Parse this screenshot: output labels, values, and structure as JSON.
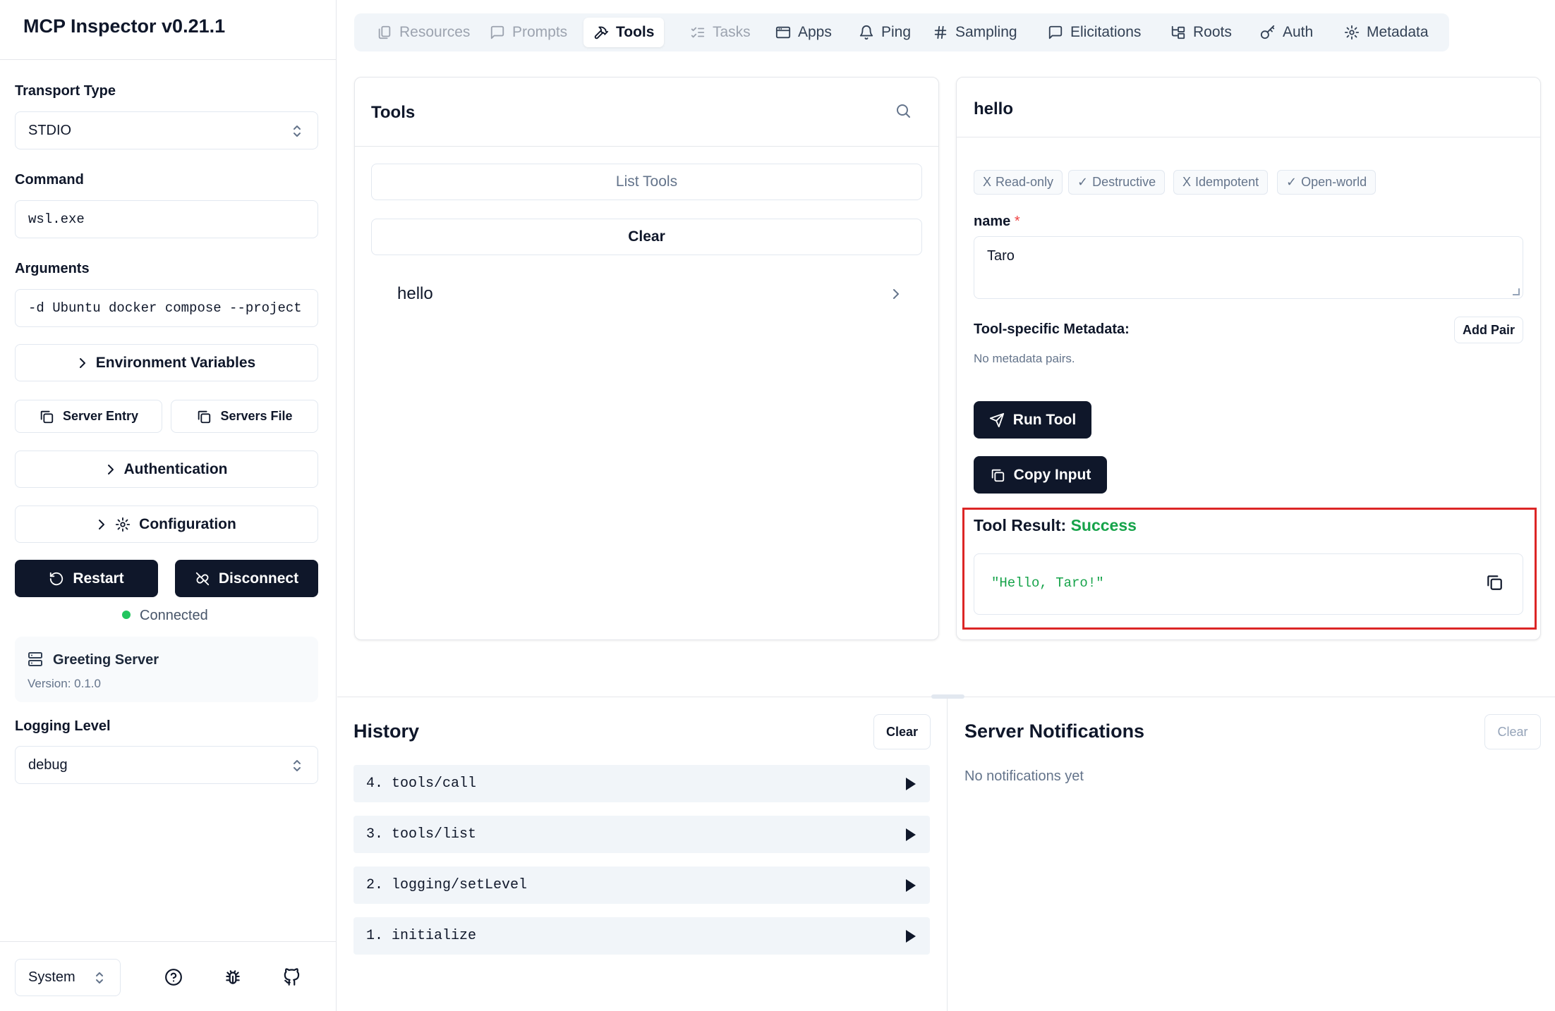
{
  "app": {
    "title": "MCP Inspector v0.21.1"
  },
  "sidebar": {
    "transport_label": "Transport Type",
    "transport_value": "STDIO",
    "command_label": "Command",
    "command_value": "wsl.exe",
    "arguments_label": "Arguments",
    "arguments_value": "-d Ubuntu docker compose --project",
    "env_vars_label": "Environment Variables",
    "server_entry_label": "Server Entry",
    "servers_file_label": "Servers File",
    "auth_label": "Authentication",
    "config_label": "Configuration",
    "restart_label": "Restart",
    "disconnect_label": "Disconnect",
    "status_text": "Connected",
    "status_color": "#22c55e",
    "server_name": "Greeting Server",
    "server_version": "Version: 0.1.0",
    "logging_label": "Logging Level",
    "logging_value": "debug",
    "theme_value": "System"
  },
  "tabs": [
    {
      "label": "Resources",
      "icon": "files-icon",
      "state": "disabled"
    },
    {
      "label": "Prompts",
      "icon": "message-square-icon",
      "state": "disabled"
    },
    {
      "label": "Tools",
      "icon": "hammer-icon",
      "state": "active"
    },
    {
      "label": "Tasks",
      "icon": "list-checks-icon",
      "state": "disabled"
    },
    {
      "label": "Apps",
      "icon": "app-window-icon",
      "state": "enabled"
    },
    {
      "label": "Ping",
      "icon": "bell-icon",
      "state": "enabled"
    },
    {
      "label": "Sampling",
      "icon": "hash-icon",
      "state": "enabled"
    },
    {
      "label": "Elicitations",
      "icon": "message-square-icon",
      "state": "enabled"
    },
    {
      "label": "Roots",
      "icon": "folder-tree-icon",
      "state": "enabled"
    },
    {
      "label": "Auth",
      "icon": "key-icon",
      "state": "enabled"
    },
    {
      "label": "Metadata",
      "icon": "gear-icon",
      "state": "enabled"
    }
  ],
  "tools_panel": {
    "title": "Tools",
    "list_tools_label": "List Tools",
    "clear_label": "Clear",
    "items": [
      {
        "name": "hello"
      }
    ]
  },
  "tool_detail": {
    "title": "hello",
    "annotations": [
      {
        "mark": "X",
        "label": "Read-only"
      },
      {
        "mark": "✓",
        "label": "Destructive"
      },
      {
        "mark": "X",
        "label": "Idempotent"
      },
      {
        "mark": "✓",
        "label": "Open-world"
      }
    ],
    "param_name": "name",
    "param_required_mark": "*",
    "param_value": "Taro",
    "metadata_label": "Tool-specific Metadata:",
    "add_pair_label": "Add Pair",
    "no_metadata_text": "No metadata pairs.",
    "run_tool_label": "Run Tool",
    "copy_input_label": "Copy Input",
    "result_label": "Tool Result:",
    "result_status": "Success",
    "result_status_color": "#16a34a",
    "result_value": "\"Hello, Taro!\"",
    "highlight_color": "#dc2626"
  },
  "history": {
    "title": "History",
    "clear_label": "Clear",
    "items": [
      {
        "label": "4. tools/call"
      },
      {
        "label": "3. tools/list"
      },
      {
        "label": "2. logging/setLevel"
      },
      {
        "label": "1. initialize"
      }
    ]
  },
  "notifications": {
    "title": "Server Notifications",
    "clear_label": "Clear",
    "empty_text": "No notifications yet"
  }
}
